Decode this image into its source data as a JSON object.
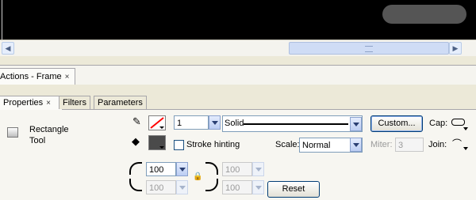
{
  "scrollbar": {
    "left_arrow": "◀",
    "right_arrow": "▶"
  },
  "panels": {
    "actions_tab": "Actions - Frame",
    "close_glyph": "×"
  },
  "property_tabs": [
    {
      "label": "Properties",
      "active": true
    },
    {
      "label": "Filters",
      "active": false
    },
    {
      "label": "Parameters",
      "active": false
    }
  ],
  "tool": {
    "name": "Rectangle Tool"
  },
  "stroke": {
    "color": "#ff0000",
    "height": "1",
    "style": "Solid",
    "custom_button": "Custom...",
    "cap_label": "Cap:",
    "join_label": "Join:",
    "hinting_label": "Stroke hinting",
    "hinting_checked": false,
    "scale_label": "Scale:",
    "scale_value": "Normal",
    "miter_label": "Miter:",
    "miter_value": "3"
  },
  "fill": {
    "color": "#4a4a4a"
  },
  "corners": {
    "top_left": "100",
    "top_right": "100",
    "bottom_left": "100",
    "bottom_right": "100",
    "reset_button": "Reset"
  },
  "icons": {
    "pencil": "pencil-icon",
    "bucket": "paint-bucket-icon",
    "lock": "lock-icon",
    "cap": "cap-round-icon",
    "join": "join-round-icon"
  }
}
